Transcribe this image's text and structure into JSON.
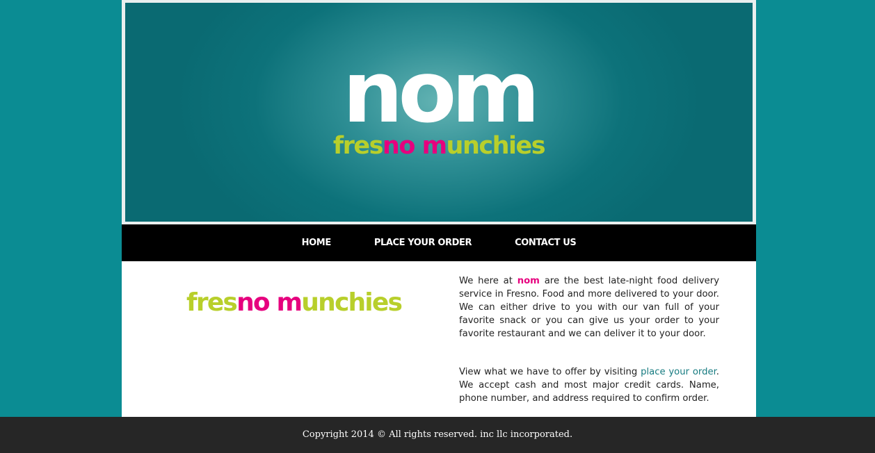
{
  "colors": {
    "background": "#0b8c93",
    "accent_green": "#b8cf2b",
    "accent_pink": "#e6007e",
    "link": "#167b80",
    "nav_bg": "#000000",
    "footer_bg": "#262626"
  },
  "banner": {
    "logo_main": "nom",
    "logo_sub_part1": "fres",
    "logo_sub_part2": "no",
    "logo_sub_part3": " m",
    "logo_sub_part4": "unchies"
  },
  "nav": {
    "items": [
      {
        "label": "HOME"
      },
      {
        "label": "PLACE YOUR ORDER"
      },
      {
        "label": "CONTACT US"
      }
    ]
  },
  "content": {
    "title_part1": "fres",
    "title_part2": "no",
    "title_part3": " m",
    "title_part4": "unchies",
    "para1_before": "We here at ",
    "para1_brand": "nom",
    "para1_after": " are the best late-night food delivery service in Fresno. Food and more delivered to your door. We can either drive to you with our van full of your favorite snack or you can give us your order to your favorite restaurant and we can deliver it to your door.",
    "para2_before": "View what we have to offer by visiting ",
    "para2_link": "place your order",
    "para2_after": ". We accept cash and most major credit cards. Name, phone number, and address required to confirm order."
  },
  "footer": {
    "copyright": "Copyright 2014 © All rights reserved. inc llc incorporated."
  }
}
